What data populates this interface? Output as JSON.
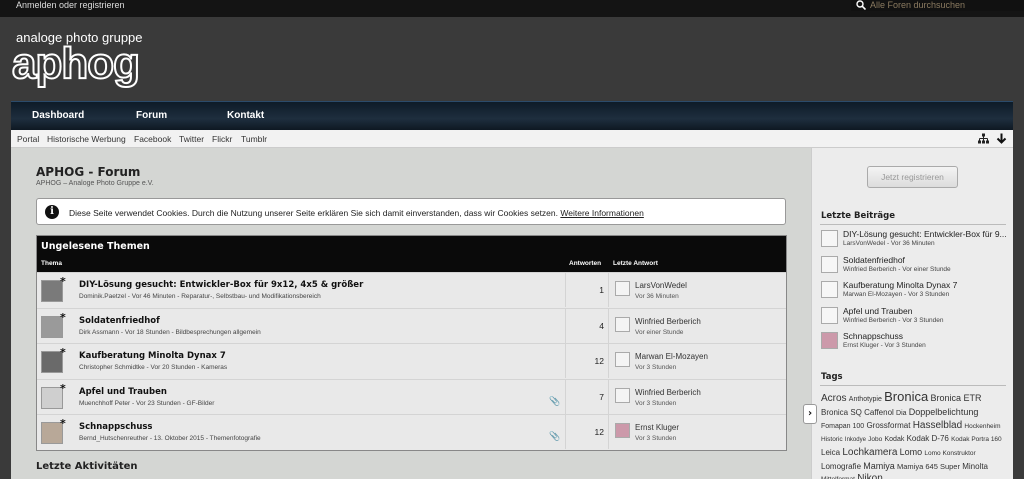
{
  "topbar": {
    "login_label": "Anmelden oder registrieren",
    "search_placeholder": "Alle Foren durchsuchen"
  },
  "logo": {
    "subtitle": "analoge photo gruppe",
    "wordmark": "aphog"
  },
  "nav": {
    "items": [
      "Dashboard",
      "Forum",
      "Kontakt"
    ]
  },
  "subnav": {
    "links": [
      "Portal",
      "Historische Werbung",
      "Facebook",
      "Twitter",
      "Flickr",
      "Tumblr"
    ],
    "icons": [
      "sitemap-icon",
      "arrow-down-icon"
    ]
  },
  "page": {
    "title": "APHOG - Forum",
    "subtitle": "APHOG – Analoge Photo Gruppe e.V."
  },
  "cookie": {
    "text": "Diese Seite verwendet Cookies. Durch die Nutzung unserer Seite erklären Sie sich damit einverstanden, dass wir Cookies setzen.",
    "link": "Weitere Informationen"
  },
  "threads": {
    "heading": "Ungelesene Themen",
    "col_topic": "Thema",
    "col_replies": "Antworten",
    "col_last": "Letzte Antwort",
    "rows": [
      {
        "title": "DIY-Lösung gesucht: Entwickler-Box für 9x12, 4x5 & größer",
        "meta": "Dominik.Paetzel - Vor 46 Minuten - Reparatur-, Selbstbau- und Modifikationsbereich",
        "replies": "1",
        "last_user": "LarsVonWedel",
        "last_time": "Vor 36 Minuten",
        "attachment": false
      },
      {
        "title": "Soldatenfriedhof",
        "meta": "Dirk Assmann - Vor 18 Stunden - Bildbesprechungen allgemein",
        "replies": "4",
        "last_user": "Winfried Berberich",
        "last_time": "Vor einer Stunde",
        "attachment": false
      },
      {
        "title": "Kaufberatung Minolta Dynax 7",
        "meta": "Christopher Schmidtke - Vor 20 Stunden - Kameras",
        "replies": "12",
        "last_user": "Marwan El-Mozayen",
        "last_time": "Vor 3 Stunden",
        "attachment": false
      },
      {
        "title": "Apfel und Trauben",
        "meta": "Muenchhoff Peter - Vor 23 Stunden - GF-Bilder",
        "replies": "7",
        "last_user": "Winfried Berberich",
        "last_time": "Vor 3 Stunden",
        "attachment": true
      },
      {
        "title": "Schnappschuss",
        "meta": "Bernd_Hutschenreuther - 13. Oktober 2015 - Themenfotografie",
        "replies": "12",
        "last_user": "Ernst Kluger",
        "last_time": "Vor 3 Stunden",
        "attachment": true
      }
    ]
  },
  "activity_heading": "Letzte Aktivitäten",
  "sidebar": {
    "register_label": "Jetzt registrieren",
    "recent_heading": "Letzte Beiträge",
    "recent": [
      {
        "title": "DIY-Lösung gesucht: Entwickler-Box für 9...",
        "meta": "LarsVonWedel - Vor 36 Minuten"
      },
      {
        "title": "Soldatenfriedhof",
        "meta": "Winfried Berberich - Vor einer Stunde"
      },
      {
        "title": "Kaufberatung Minolta Dynax 7",
        "meta": "Marwan El-Mozayen - Vor 3 Stunden"
      },
      {
        "title": "Apfel und Trauben",
        "meta": "Winfried Berberich - Vor 3 Stunden"
      },
      {
        "title": "Schnappschuss",
        "meta": "Ernst Kluger - Vor 3 Stunden"
      }
    ],
    "tags_heading": "Tags",
    "tags": [
      {
        "t": "Acros",
        "s": 10
      },
      {
        "t": "Anthotypie",
        "s": 7
      },
      {
        "t": "Bronica",
        "s": 13
      },
      {
        "t": "Bronica ETR",
        "s": 9
      },
      {
        "t": "Bronica SQ",
        "s": 8
      },
      {
        "t": "Caffenol",
        "s": 8
      },
      {
        "t": "Dia",
        "s": 7
      },
      {
        "t": "Doppelbelichtung",
        "s": 9
      },
      {
        "t": "Fomapan 100",
        "s": 7
      },
      {
        "t": "Grossformat",
        "s": 8
      },
      {
        "t": "Hasselblad",
        "s": 10
      },
      {
        "t": "Hockenheim",
        "s": 6.5
      },
      {
        "t": "Historic",
        "s": 6.5
      },
      {
        "t": "Inkodye",
        "s": 6
      },
      {
        "t": "Jobo",
        "s": 6.5
      },
      {
        "t": "Kodak",
        "s": 7
      },
      {
        "t": "Kodak D-76",
        "s": 8
      },
      {
        "t": "Kodak Portra 160",
        "s": 6.5
      },
      {
        "t": "Leica",
        "s": 8
      },
      {
        "t": "Lochkamera",
        "s": 10
      },
      {
        "t": "Lomo",
        "s": 9
      },
      {
        "t": "Lomo Konstruktor",
        "s": 6.5
      },
      {
        "t": "Lomografie",
        "s": 8
      },
      {
        "t": "Mamiya",
        "s": 9
      },
      {
        "t": "Mamiya 645 Super",
        "s": 7.5
      },
      {
        "t": "Minolta",
        "s": 8
      },
      {
        "t": "Mittelformat",
        "s": 6.5
      },
      {
        "t": "Nikon",
        "s": 10
      }
    ]
  }
}
